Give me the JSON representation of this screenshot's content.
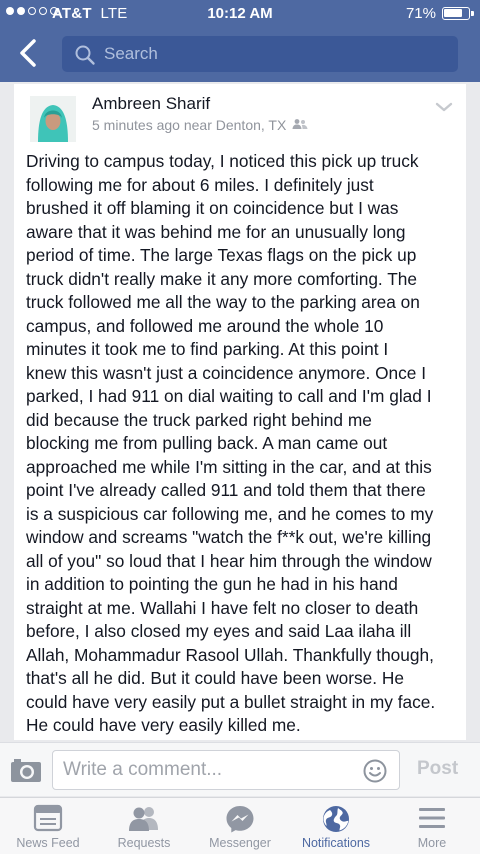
{
  "status_bar": {
    "carrier": "AT&T",
    "network": "LTE",
    "time": "10:12 AM",
    "battery": "71%",
    "battery_level": 0.71
  },
  "nav": {
    "search_placeholder": "Search"
  },
  "post": {
    "author": "Ambreen Sharif",
    "meta": "5 minutes ago near Denton, TX",
    "lines": [
      "Driving to campus today, I noticed this pick up truck",
      "following me for about 6 miles. I definitely just",
      "brushed it off blaming it on coincidence but I was",
      "aware that it was behind me for an unusually long",
      "period of time. The large Texas flags on the pick up",
      "truck didn't really make it any more comforting. The",
      "truck followed me all the way to the parking area on",
      "campus, and followed me around the whole 10",
      "minutes it took me to find parking. At this point I",
      "knew this wasn't just a coincidence anymore. Once I",
      "parked, I had 911 on dial waiting to call and I'm glad I",
      "did because the truck parked right behind me",
      "blocking me from pulling back. A man came out",
      "approached me while I'm sitting in the car, and at this",
      "point I've already called 911 and told them that there",
      "is a suspicious car following me, and he comes to my",
      "window and screams \"watch the f**k out, we're killing",
      "all of you\" so loud that I hear him through the window",
      "in addition to pointing the gun he had in his hand",
      "straight at me. Wallahi I have felt no closer to death",
      "before, I also closed my eyes and said Laa ilaha ill",
      "Allah, Mohammadur Rasool Ullah. Thankfully though,",
      "that's all he did. But it could have been worse. He",
      "could have very easily put a bullet straight in my face.",
      "He could have very easily killed me."
    ]
  },
  "comment": {
    "placeholder": "Write a comment...",
    "post_label": "Post"
  },
  "tabs": [
    {
      "label": "News Feed",
      "icon": "news-feed-icon",
      "active": false
    },
    {
      "label": "Requests",
      "icon": "requests-icon",
      "active": false
    },
    {
      "label": "Messenger",
      "icon": "messenger-icon",
      "active": false
    },
    {
      "label": "Notifications",
      "icon": "globe-icon",
      "active": true
    },
    {
      "label": "More",
      "icon": "menu-icon",
      "active": false
    }
  ],
  "colors": {
    "brand": "#4e69a2",
    "active_tab": "#4e69a2",
    "inactive_tab": "#9197a3"
  }
}
